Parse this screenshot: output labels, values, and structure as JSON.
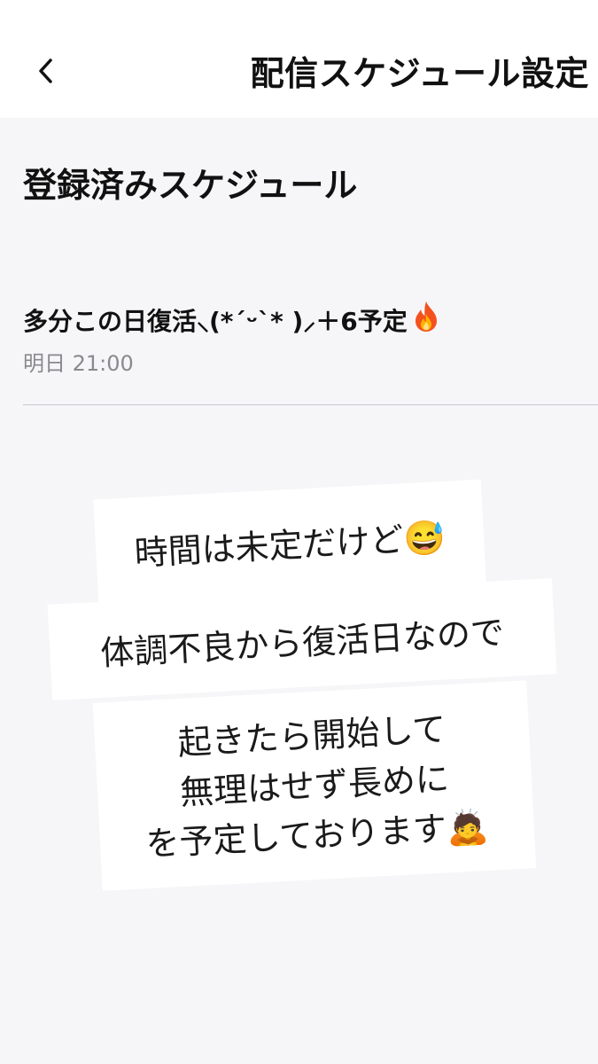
{
  "header": {
    "title": "配信スケジュール設定",
    "back_icon": "chevron-left-icon"
  },
  "section": {
    "title": "登録済みスケジュール"
  },
  "schedule": {
    "title": "多分この日復活‪⸜(*ˊᵕˋ* )⸝‬＋6予定",
    "title_icon": "fire-icon",
    "time": "明日 21:00"
  },
  "notes": {
    "note1": "時間は未定だけど😅",
    "note2": "体調不良から復活日なので",
    "note3": {
      "line1": "起きたら開始して",
      "line2": "無理はせず長めに",
      "line3": "を予定しております🙇"
    }
  },
  "colors": {
    "header_bg": "#ffffff",
    "page_bg": "#f6f6f8",
    "secondary_text": "#8a8a8e",
    "divider": "#c9c9cd",
    "flame_orange": "#f4511e"
  }
}
